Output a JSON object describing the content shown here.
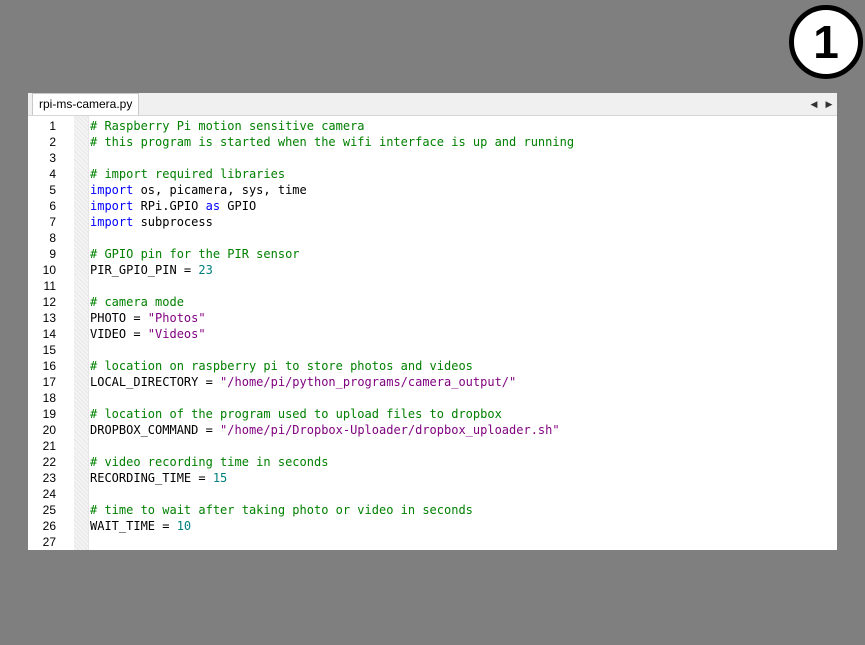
{
  "badge": {
    "label": "1"
  },
  "editor": {
    "tab_label": "rpi-ms-camera.py",
    "scroll_left": "◀",
    "scroll_right": "▶"
  },
  "colors": {
    "background": "#7f7f7f",
    "comment": "#008000",
    "keyword": "#0000ff",
    "string": "#7f007f",
    "number": "#007f7f"
  },
  "lines": [
    {
      "num": "1",
      "tokens": [
        {
          "t": "comment",
          "v": "# Raspberry Pi motion sensitive camera"
        }
      ]
    },
    {
      "num": "2",
      "tokens": [
        {
          "t": "comment",
          "v": "# this program is started when the wifi interface is up and running"
        }
      ]
    },
    {
      "num": "3",
      "tokens": []
    },
    {
      "num": "4",
      "tokens": [
        {
          "t": "comment",
          "v": "# import required libraries"
        }
      ]
    },
    {
      "num": "5",
      "tokens": [
        {
          "t": "keyword",
          "v": "import"
        },
        {
          "t": "plain",
          "v": " os, picamera, sys, time"
        }
      ]
    },
    {
      "num": "6",
      "tokens": [
        {
          "t": "keyword",
          "v": "import"
        },
        {
          "t": "plain",
          "v": " RPi.GPIO "
        },
        {
          "t": "keyword",
          "v": "as"
        },
        {
          "t": "plain",
          "v": " GPIO"
        }
      ]
    },
    {
      "num": "7",
      "tokens": [
        {
          "t": "keyword",
          "v": "import"
        },
        {
          "t": "plain",
          "v": " subprocess"
        }
      ]
    },
    {
      "num": "8",
      "tokens": []
    },
    {
      "num": "9",
      "tokens": [
        {
          "t": "comment",
          "v": "# GPIO pin for the PIR sensor"
        }
      ]
    },
    {
      "num": "10",
      "tokens": [
        {
          "t": "plain",
          "v": "PIR_GPIO_PIN = "
        },
        {
          "t": "number",
          "v": "23"
        }
      ]
    },
    {
      "num": "11",
      "tokens": []
    },
    {
      "num": "12",
      "tokens": [
        {
          "t": "comment",
          "v": "# camera mode"
        }
      ]
    },
    {
      "num": "13",
      "tokens": [
        {
          "t": "plain",
          "v": "PHOTO = "
        },
        {
          "t": "string",
          "v": "\"Photos\""
        }
      ]
    },
    {
      "num": "14",
      "tokens": [
        {
          "t": "plain",
          "v": "VIDEO = "
        },
        {
          "t": "string",
          "v": "\"Videos\""
        }
      ]
    },
    {
      "num": "15",
      "tokens": []
    },
    {
      "num": "16",
      "tokens": [
        {
          "t": "comment",
          "v": "# location on raspberry pi to store photos and videos"
        }
      ]
    },
    {
      "num": "17",
      "tokens": [
        {
          "t": "plain",
          "v": "LOCAL_DIRECTORY = "
        },
        {
          "t": "string",
          "v": "\"/home/pi/python_programs/camera_output/\""
        }
      ]
    },
    {
      "num": "18",
      "tokens": []
    },
    {
      "num": "19",
      "tokens": [
        {
          "t": "comment",
          "v": "# location of the program used to upload files to dropbox"
        }
      ]
    },
    {
      "num": "20",
      "tokens": [
        {
          "t": "plain",
          "v": "DROPBOX_COMMAND = "
        },
        {
          "t": "string",
          "v": "\"/home/pi/Dropbox-Uploader/dropbox_uploader.sh\""
        }
      ]
    },
    {
      "num": "21",
      "tokens": []
    },
    {
      "num": "22",
      "tokens": [
        {
          "t": "comment",
          "v": "# video recording time in seconds"
        }
      ]
    },
    {
      "num": "23",
      "tokens": [
        {
          "t": "plain",
          "v": "RECORDING_TIME = "
        },
        {
          "t": "number",
          "v": "15"
        }
      ]
    },
    {
      "num": "24",
      "tokens": []
    },
    {
      "num": "25",
      "tokens": [
        {
          "t": "comment",
          "v": "# time to wait after taking photo or video in seconds"
        }
      ]
    },
    {
      "num": "26",
      "tokens": [
        {
          "t": "plain",
          "v": "WAIT_TIME = "
        },
        {
          "t": "number",
          "v": "10"
        }
      ]
    },
    {
      "num": "27",
      "tokens": []
    }
  ]
}
